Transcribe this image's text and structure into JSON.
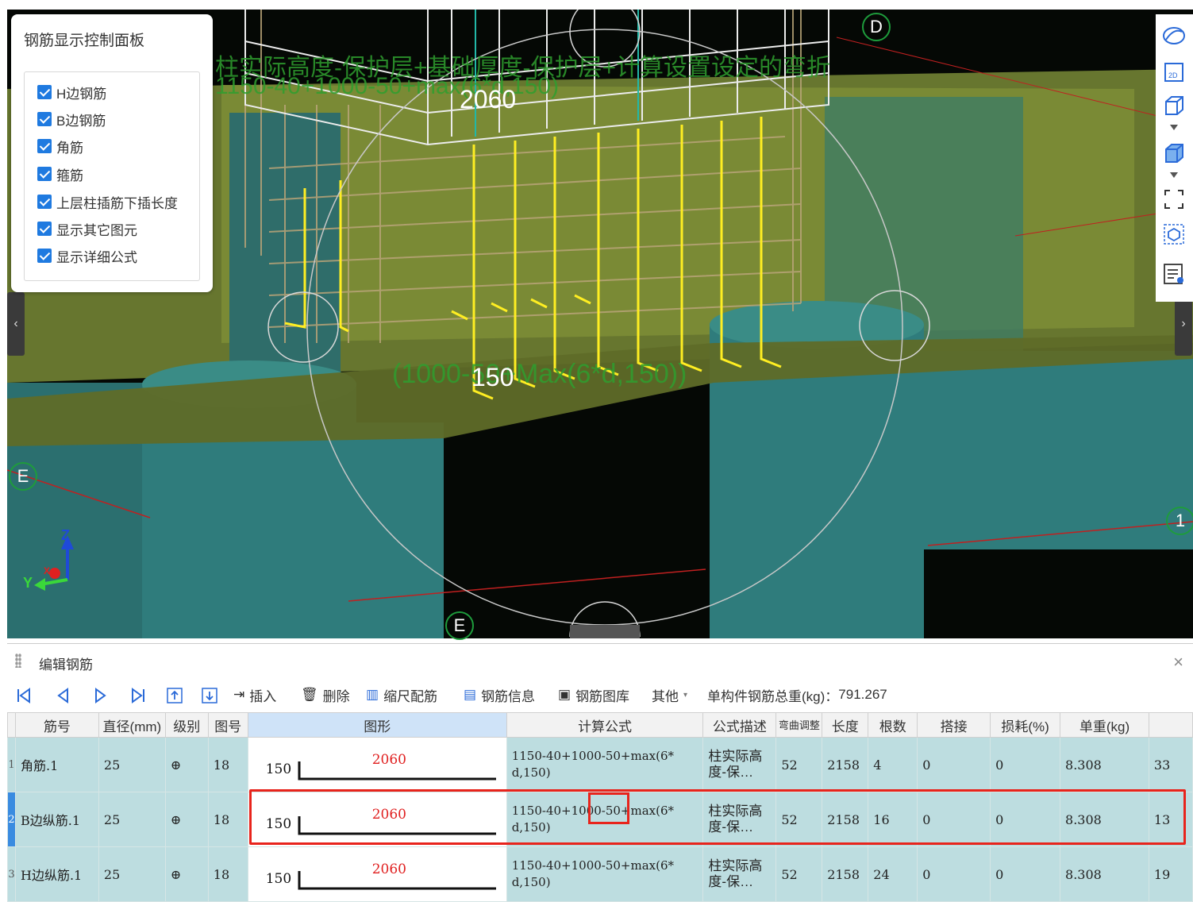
{
  "viewport": {
    "panel": {
      "title": "钢筋显示控制面板",
      "checkboxes": [
        {
          "label": "H边钢筋",
          "checked": true
        },
        {
          "label": "B边钢筋",
          "checked": true
        },
        {
          "label": "角筋",
          "checked": true
        },
        {
          "label": "箍筋",
          "checked": true
        },
        {
          "label": "上层柱插筋下插长度",
          "checked": true
        },
        {
          "label": "显示其它图元",
          "checked": true
        },
        {
          "label": "显示详细公式",
          "checked": true
        }
      ]
    },
    "annotations": {
      "formula_desc": "柱实际高度-保护层+基础厚度-保护层+计算设置设定的弯折",
      "formula_value": "1150-40+1000-50+max(6*d,150)",
      "length_label": "2060",
      "bend_formula": "(1000-50+Max(6*d,150))",
      "bend_label": "150"
    },
    "grid_labels": {
      "top": "D",
      "left": "E",
      "right": "1",
      "bottom": "E"
    },
    "axes": {
      "z": "Z",
      "y": "Y",
      "x": "X"
    },
    "right_toolbar": [
      "orbit-icon",
      "2d-view-icon",
      "cube-outline-icon",
      "cube-solid-icon",
      "fullscreen-icon",
      "box-select-icon",
      "rebar-list-icon"
    ]
  },
  "editor": {
    "title": "编辑钢筋",
    "toolbar": {
      "insert": "插入",
      "delete": "删除",
      "scale": "缩尺配筋",
      "info": "钢筋信息",
      "library": "钢筋图库",
      "other": "其他",
      "total_label": "单构件钢筋总重(kg)：",
      "total_value": "791.267"
    },
    "columns": [
      "筋号",
      "直径(mm)",
      "级别",
      "图号",
      "图形",
      "计算公式",
      "公式描述",
      "弯曲调整",
      "长度",
      "根数",
      "搭接",
      "损耗(%)",
      "单重(kg)"
    ],
    "rows": [
      {
        "idx": "1",
        "name": "角筋.1",
        "dia": "25",
        "grade": "⊕",
        "fig": "18",
        "bend": "150",
        "len_label": "2060",
        "formula": "1150-40+1000-50+max(6*d,150)",
        "desc": "柱实际高度-保…",
        "adj": "52",
        "length": "2158",
        "count": "4",
        "lap": "0",
        "loss": "0",
        "unit": "8.308",
        "total": "33"
      },
      {
        "idx": "2",
        "name": "B边纵筋.1",
        "dia": "25",
        "grade": "⊕",
        "fig": "18",
        "bend": "150",
        "len_label": "2060",
        "formula": "1150-40+1000-50+max(6*d,150)",
        "desc": "柱实际高度-保…",
        "adj": "52",
        "length": "2158",
        "count": "16",
        "lap": "0",
        "loss": "0",
        "unit": "8.308",
        "total": "13"
      },
      {
        "idx": "3",
        "name": "H边纵筋.1",
        "dia": "25",
        "grade": "⊕",
        "fig": "18",
        "bend": "150",
        "len_label": "2060",
        "formula": "1150-40+1000-50+max(6*d,150)",
        "desc": "柱实际高度-保…",
        "adj": "52",
        "length": "2158",
        "count": "24",
        "lap": "0",
        "loss": "0",
        "unit": "8.308",
        "total": "19"
      }
    ]
  }
}
